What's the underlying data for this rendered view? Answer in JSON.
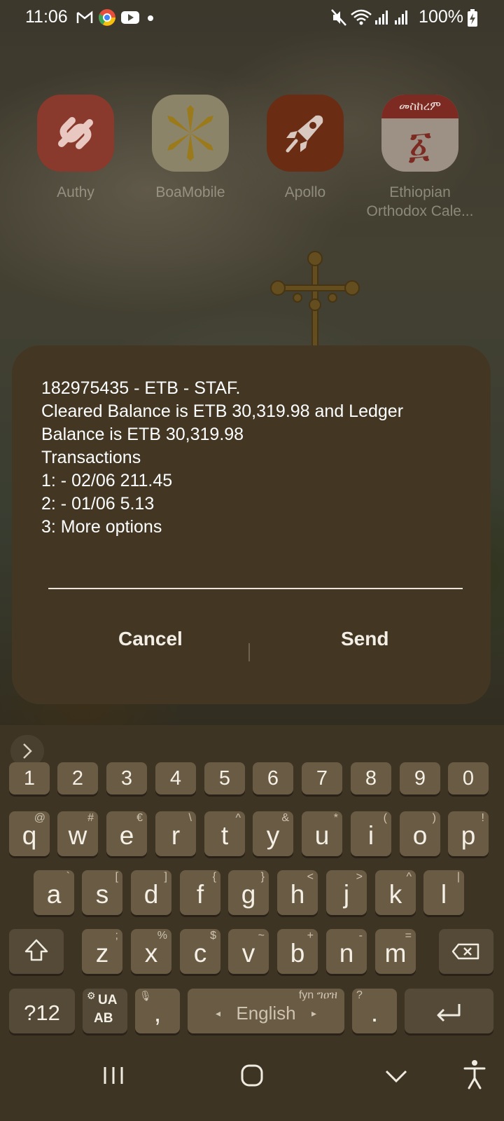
{
  "status_bar": {
    "time": "11:06",
    "battery": "100%"
  },
  "apps": [
    {
      "label": "Authy",
      "icon": "authy-icon"
    },
    {
      "label": "BoaMobile",
      "icon": "boamobile-icon"
    },
    {
      "label": "Apollo",
      "icon": "apollo-rocket-icon"
    },
    {
      "label": "Ethiopian Orthodox Cale...",
      "icon": "ethiopian-calendar-icon",
      "icon_text": "መስከረም",
      "icon_glyph": "፩"
    }
  ],
  "dialog": {
    "message": "182975435 - ETB - STAF.\nCleared Balance is ETB 30,319.98 and Ledger Balance is ETB 30,319.98\nTransactions\n1: - 02/06 211.45\n2: - 01/06 5.13\n3: More options",
    "input_value": "",
    "cancel_label": "Cancel",
    "send_label": "Send"
  },
  "keyboard": {
    "numbers": [
      "1",
      "2",
      "3",
      "4",
      "5",
      "6",
      "7",
      "8",
      "9",
      "0"
    ],
    "row1": [
      [
        "q",
        "@"
      ],
      [
        "w",
        "#"
      ],
      [
        "e",
        "€"
      ],
      [
        "r",
        "\\"
      ],
      [
        "t",
        "^"
      ],
      [
        "y",
        "&"
      ],
      [
        "u",
        "*"
      ],
      [
        "i",
        "("
      ],
      [
        "o",
        ")"
      ],
      [
        "p",
        "!"
      ]
    ],
    "row2": [
      [
        "a",
        "`"
      ],
      [
        "s",
        "["
      ],
      [
        "d",
        "]"
      ],
      [
        "f",
        "{"
      ],
      [
        "g",
        "}"
      ],
      [
        "h",
        "<"
      ],
      [
        "j",
        ">"
      ],
      [
        "k",
        "^"
      ],
      [
        "l",
        "|"
      ]
    ],
    "row3": [
      [
        "z",
        ";"
      ],
      [
        "x",
        "%"
      ],
      [
        "c",
        "$"
      ],
      [
        "v",
        "~"
      ],
      [
        "b",
        "+"
      ],
      [
        "n",
        "-"
      ],
      [
        "m",
        "="
      ]
    ],
    "symbols_label": "?12",
    "lang_switch_top": "UA",
    "lang_switch_bottom": "AB",
    "comma": ",",
    "space_label": "English",
    "space_hint": "fyn ግዐዝ",
    "period": ".",
    "period_hint": "?"
  },
  "colors": {
    "dialog_bg": "#433724",
    "keyboard_bg": "#3d3424",
    "key_bg": "#6a5b44"
  }
}
